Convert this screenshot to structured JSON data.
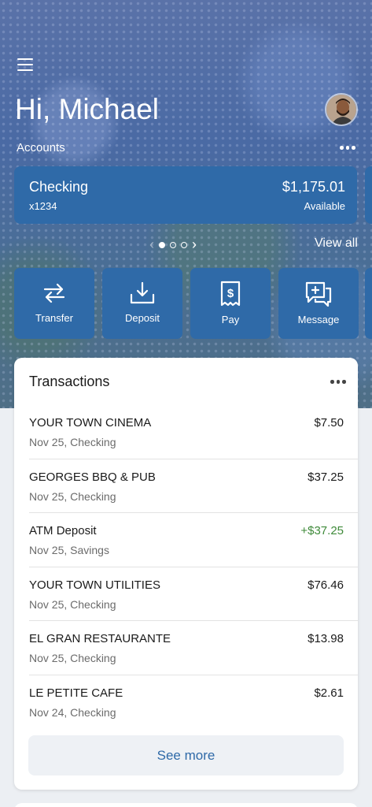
{
  "header": {
    "greeting": "Hi, Michael",
    "menu_icon": "hamburger-menu-icon",
    "avatar_icon": "user-avatar"
  },
  "accounts": {
    "label": "Accounts",
    "more_icon": "more-horizontal-icon",
    "current": {
      "name": "Checking",
      "number": "x1234",
      "balance": "$1,175.01",
      "balance_label": "Available"
    },
    "pager": {
      "total": 3,
      "active_index": 0
    },
    "view_all": "View all"
  },
  "actions": [
    {
      "label": "Transfer",
      "icon": "transfer-icon"
    },
    {
      "label": "Deposit",
      "icon": "deposit-icon"
    },
    {
      "label": "Pay",
      "icon": "pay-bill-icon"
    },
    {
      "label": "Message",
      "icon": "message-icon"
    }
  ],
  "transactions": {
    "title": "Transactions",
    "items": [
      {
        "name": "YOUR TOWN CINEMA",
        "sub": "Nov 25, Checking",
        "amount": "$7.50",
        "credit": false
      },
      {
        "name": "GEORGES BBQ & PUB",
        "sub": "Nov 25, Checking",
        "amount": "$37.25",
        "credit": false
      },
      {
        "name": "ATM Deposit",
        "sub": "Nov 25, Savings",
        "amount": "+$37.25",
        "credit": true
      },
      {
        "name": "YOUR TOWN UTILITIES",
        "sub": "Nov 25, Checking",
        "amount": "$76.46",
        "credit": false
      },
      {
        "name": "EL GRAN RESTAURANTE",
        "sub": "Nov 25, Checking",
        "amount": "$13.98",
        "credit": false
      },
      {
        "name": "LE PETITE CAFE",
        "sub": "Nov 24, Checking",
        "amount": "$2.61",
        "credit": false
      }
    ],
    "see_more": "See more"
  },
  "colors": {
    "accent": "#2f6aa8",
    "credit": "#3f8a3a",
    "page_bg": "#eceff3"
  }
}
